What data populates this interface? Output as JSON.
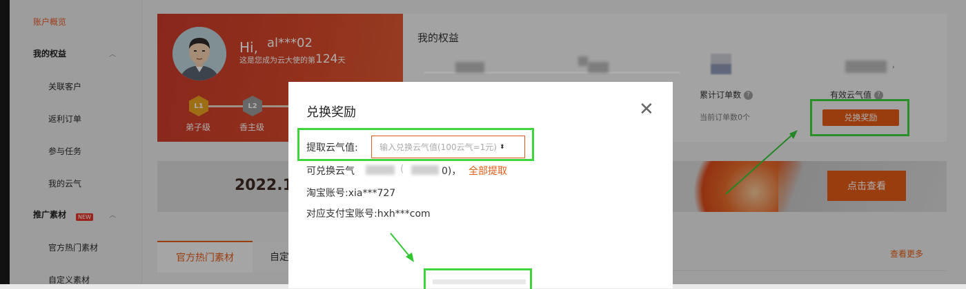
{
  "sidebar": {
    "items": [
      {
        "label": "账户概览",
        "active": true
      },
      {
        "label": "我的权益",
        "section": true
      },
      {
        "label": "关联客户"
      },
      {
        "label": "返利订单"
      },
      {
        "label": "参与任务"
      },
      {
        "label": "我的云气"
      },
      {
        "label": "推广素材",
        "section": true,
        "badge": "NEW"
      },
      {
        "label": "官方热门素材"
      },
      {
        "label": "自定义素材"
      }
    ]
  },
  "profile": {
    "greeting": "Hi,",
    "username": "al***02",
    "subtitle_prefix": "这是您成为云大使的第",
    "days": "124",
    "subtitle_suffix": "天",
    "levels": [
      {
        "icon": "L1",
        "label": "弟子级",
        "color": "#e9a21f"
      },
      {
        "icon": "L2",
        "label": "香主级",
        "color": "#9a9a9a"
      }
    ]
  },
  "rights": {
    "title": "我的权益",
    "orders_label": "累计订单数",
    "orders_sub": "当前订单数0个",
    "cloud_label": "有效云气值",
    "exchange_button": "兑换奖励"
  },
  "banner": {
    "date": "2022.1",
    "button": "点击查看"
  },
  "tabs": [
    {
      "label": "官方热门素材"
    },
    {
      "label": "自定"
    }
  ],
  "see_more": "查看更多",
  "modal": {
    "title": "兑换奖励",
    "withdraw_label": "提取云气值:",
    "input_placeholder": "输入兑换云气值(100云气=1元)",
    "available_prefix": "可兑换云气",
    "available_suffix": "0)，",
    "withdraw_all": "全部提取",
    "taobao_label": "淘宝账号:",
    "taobao_value": "xia***727",
    "alipay_label": "对应支付宝账号:",
    "alipay_value": "hxh***com"
  },
  "colors": {
    "accent": "#e35a16",
    "highlight": "#3dd43d",
    "profile_red": "#d6472a"
  }
}
